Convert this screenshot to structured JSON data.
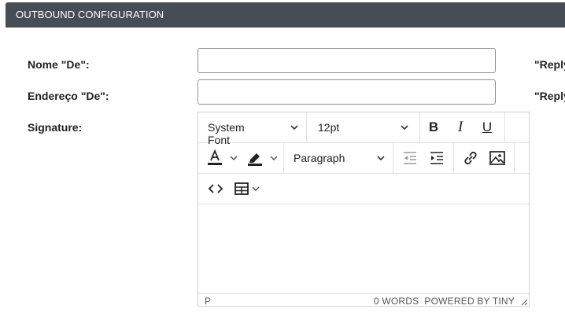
{
  "panel": {
    "title": "OUTBOUND CONFIGURATION"
  },
  "form": {
    "from_name_label": "Nome \"De\":",
    "from_name_value": "",
    "from_address_label": "Endereço \"De\":",
    "from_address_value": "",
    "signature_label": "Signature:",
    "reply_label_1": "\"Reply",
    "reply_label_2": "\"Reply"
  },
  "editor": {
    "font_family": "System Font",
    "font_size": "12pt",
    "block_format": "Paragraph",
    "toolbar_icons": [
      "bold-icon",
      "italic-icon",
      "underline-icon",
      "text-color-icon",
      "highlight-icon",
      "outdent-icon",
      "indent-icon",
      "link-icon",
      "image-icon",
      "source-code-icon",
      "table-icon"
    ],
    "content": "",
    "status_path": "P",
    "word_count": "0 WORDS",
    "branding": "POWERED BY TINY"
  }
}
